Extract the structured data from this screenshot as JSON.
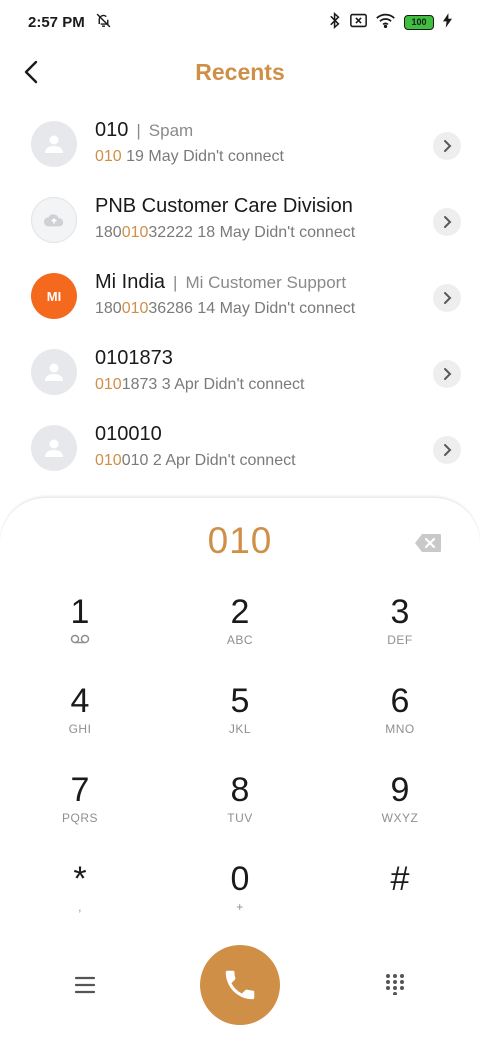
{
  "status_bar": {
    "time": "2:57 PM",
    "battery": "100",
    "icons": [
      "bell-off-icon",
      "bluetooth-icon",
      "sim-off-icon",
      "wifi-icon",
      "battery-icon",
      "charging-icon"
    ]
  },
  "header": {
    "title": "Recents",
    "back_icon": "chevron-left-icon"
  },
  "recents": [
    {
      "avatar": "person",
      "name": "010",
      "tag": "Spam",
      "number_hl_pre": "",
      "number_hl": "010",
      "number_post": "",
      "meta": " 19 May Didn't connect"
    },
    {
      "avatar": "cloud",
      "name": "PNB Customer Care Division",
      "tag": "",
      "number_hl_pre": "180",
      "number_hl": "010",
      "number_post": "32222",
      "meta": " 18 May Didn't connect"
    },
    {
      "avatar": "mi",
      "name": "Mi India",
      "tag": "Mi Customer Support",
      "number_hl_pre": "180",
      "number_hl": "010",
      "number_post": "36286",
      "meta": " 14 May Didn't connect"
    },
    {
      "avatar": "person",
      "name": "0101873",
      "tag": "",
      "number_hl_pre": "",
      "number_hl": "010",
      "number_post": "1873",
      "meta": " 3 Apr Didn't connect"
    },
    {
      "avatar": "person",
      "name": "010010",
      "tag": "",
      "number_hl_pre": "",
      "number_hl": "010",
      "number_post": "010",
      "meta": " 2 Apr Didn't connect"
    }
  ],
  "mi_logo_text": "MI",
  "dialpad": {
    "dialed": "010",
    "keys": [
      {
        "digit": "1",
        "letters": "voicemail"
      },
      {
        "digit": "2",
        "letters": "ABC"
      },
      {
        "digit": "3",
        "letters": "DEF"
      },
      {
        "digit": "4",
        "letters": "GHI"
      },
      {
        "digit": "5",
        "letters": "JKL"
      },
      {
        "digit": "6",
        "letters": "MNO"
      },
      {
        "digit": "7",
        "letters": "PQRS"
      },
      {
        "digit": "8",
        "letters": "TUV"
      },
      {
        "digit": "9",
        "letters": "WXYZ"
      },
      {
        "digit": "*",
        "letters": ","
      },
      {
        "digit": "0",
        "letters": "+"
      },
      {
        "digit": "#",
        "letters": ""
      }
    ]
  },
  "colors": {
    "accent": "#cf8f47",
    "mi_orange": "#f5691f"
  }
}
